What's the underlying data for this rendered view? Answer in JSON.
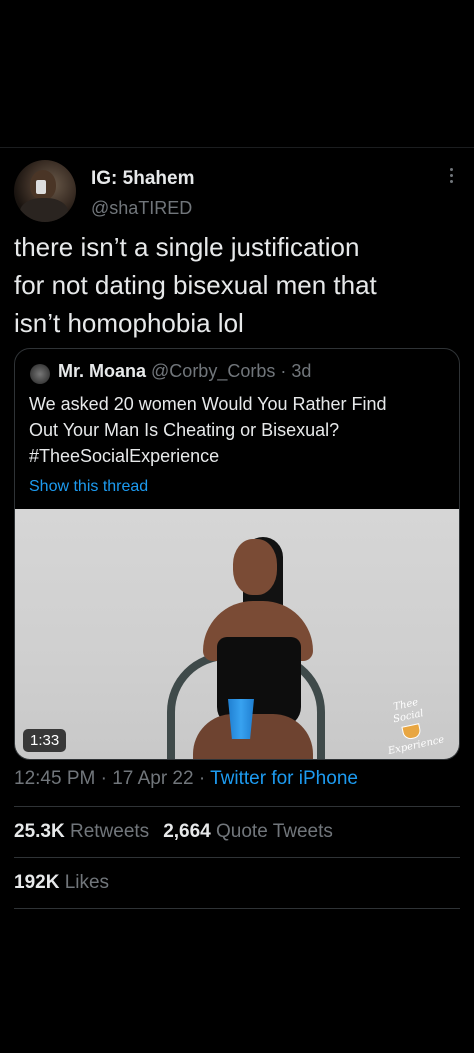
{
  "author": {
    "display_name": "IG: 5hahem",
    "handle": "@shaTIRED",
    "avatar_icon": "profile-photo",
    "more_icon": "more-vertical-icon"
  },
  "tweet": {
    "text": "there isn’t a single justification\nfor not dating bisexual men that\nisn’t homophobia lol",
    "time": "12:45 PM",
    "separator": " · ",
    "date": "17 Apr 22",
    "source": "Twitter for iPhone"
  },
  "quoted": {
    "display_name": "Mr. Moana",
    "handle": "@Corby_Corbs",
    "age": "3d",
    "text": "We asked 20 women Would You Rather Find\nOut Your Man Is Cheating or Bisexual?\n#TheeSocialExperience",
    "show_thread": "Show this thread",
    "video_duration": "1:33",
    "watermark": "Thee Social Experience"
  },
  "stats": {
    "retweets_count": "25.3K",
    "retweets_label": "Retweets",
    "quotes_count": "2,664",
    "quotes_label": "Quote Tweets",
    "likes_count": "192K",
    "likes_label": "Likes"
  },
  "colors": {
    "background": "#000000",
    "text": "#e7e9ea",
    "muted": "#71767b",
    "link": "#1d9bf0",
    "border": "#2f3336"
  }
}
